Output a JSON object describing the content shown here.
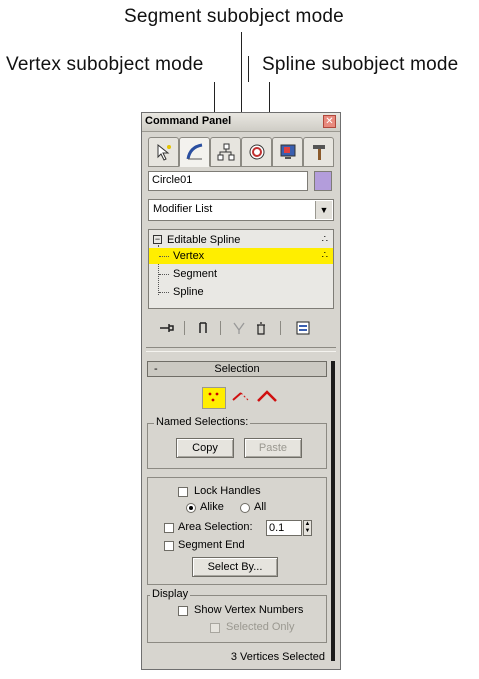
{
  "callouts": {
    "segment": "Segment subobject mode",
    "vertex": "Vertex subobject mode",
    "spline": "Spline subobject mode"
  },
  "panel": {
    "title": "Command Panel",
    "close_icon": "close-icon",
    "tabs": [
      {
        "name": "create-tab",
        "icon": "create-arrow-icon"
      },
      {
        "name": "modify-tab",
        "icon": "modify-curve-icon",
        "active": true
      },
      {
        "name": "hierarchy-tab",
        "icon": "hierarchy-icon"
      },
      {
        "name": "motion-tab",
        "icon": "motion-icon"
      },
      {
        "name": "display-tab",
        "icon": "display-monitor-icon"
      },
      {
        "name": "utilities-tab",
        "icon": "hammer-icon"
      }
    ],
    "object_name": "Circle01",
    "object_color": "#b39ddb",
    "modifier_list": "Modifier List",
    "stack": {
      "root": "Editable Spline",
      "items": [
        "Vertex",
        "Segment",
        "Spline"
      ],
      "selected": "Vertex",
      "highlight_color": "#ffee00"
    },
    "rollout": {
      "collapse": "-",
      "title": "Selection",
      "named_selections": {
        "label": "Named Selections:",
        "copy": "Copy",
        "paste": "Paste"
      },
      "lock_handles": "Lock Handles",
      "alike": "Alike",
      "all": "All",
      "area_selection": "Area Selection:",
      "area_value": "0.1",
      "segment_end": "Segment End",
      "select_by": "Select By...",
      "display": {
        "label": "Display",
        "show_vertex_numbers": "Show Vertex Numbers",
        "selected_only": "Selected Only"
      },
      "status": "3 Vertices Selected"
    }
  }
}
